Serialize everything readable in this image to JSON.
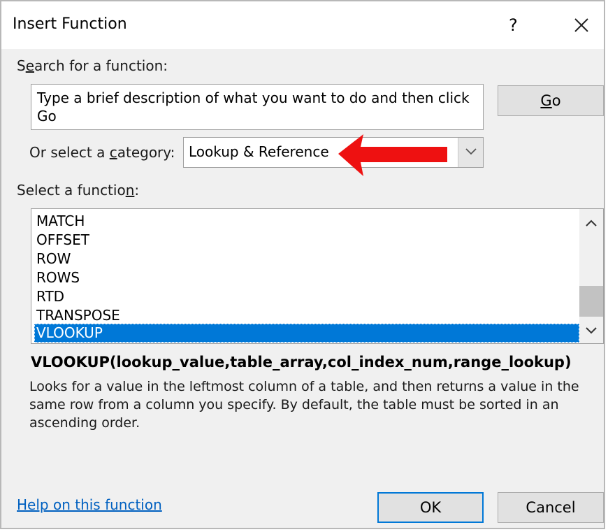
{
  "dialog": {
    "title": "Insert Function",
    "help_glyph": "?",
    "close_icon": "close-icon"
  },
  "search": {
    "label_pre": "S",
    "label_u": "e",
    "label_post": "arch for a function:",
    "value": "Type a brief description of what you want to do and then click Go",
    "go_pre": "",
    "go_u": "G",
    "go_post": "o"
  },
  "category": {
    "label_pre": "Or select a ",
    "label_u": "c",
    "label_post": "ategory:",
    "selected": "Lookup & Reference",
    "annotation": "red-arrow-pointing-left"
  },
  "functions": {
    "label_pre": "Select a functio",
    "label_u": "n",
    "label_post": ":",
    "items": [
      "MATCH",
      "OFFSET",
      "ROW",
      "ROWS",
      "RTD",
      "TRANSPOSE",
      "VLOOKUP"
    ],
    "selected_index": 6,
    "selection_color": "#0078d7"
  },
  "details": {
    "syntax": "VLOOKUP(lookup_value,table_array,col_index_num,range_lookup)",
    "description": "Looks for a value in the leftmost column of a table, and then returns a value in the same row from a column you specify. By default, the table must be sorted in an ascending order."
  },
  "footer": {
    "help_link": "Help on this function",
    "ok_label": "OK",
    "cancel_label": "Cancel"
  }
}
